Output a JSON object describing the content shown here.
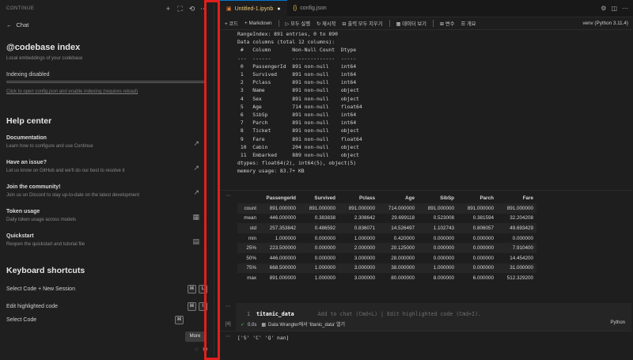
{
  "left": {
    "top_title": "CONTINUE",
    "chat_label": "Chat",
    "index": {
      "title": "@codebase index",
      "subtitle": "Local embeddings of your codebase",
      "status": "Indexing disabled",
      "link": "Click to open config.json and enable indexing (requires reload)"
    },
    "help": {
      "title": "Help center",
      "items": [
        {
          "title": "Documentation",
          "desc": "Learn how to configure and use Continue"
        },
        {
          "title": "Have an issue?",
          "desc": "Let us know on GitHub and we'll do our best to resolve it"
        },
        {
          "title": "Join the community!",
          "desc": "Join us on Discord to stay up-to-date on the latest development"
        },
        {
          "title": "Token usage",
          "desc": "Daily token usage across models"
        },
        {
          "title": "Quickstart",
          "desc": "Reopen the quickstart and tutorial file"
        }
      ]
    },
    "shortcuts": {
      "title": "Keyboard shortcuts",
      "rows": [
        {
          "label": "Select Code + New Session",
          "keys": [
            "⌘",
            "L"
          ]
        },
        {
          "label": "Edit highlighted code",
          "keys": [
            "⌘",
            "I"
          ]
        },
        {
          "label": "Select Code",
          "keys": [
            "⌘"
          ]
        }
      ]
    },
    "tooltip": "More"
  },
  "tabs": [
    {
      "name": "Untitled-1.ipynb",
      "modified": true,
      "active": true
    },
    {
      "name": "config.json",
      "modified": false,
      "active": false
    }
  ],
  "toolbar": {
    "items": [
      "+ 코드",
      "+ Markdown",
      "▷ 모두 실행",
      "↻ 재시작",
      "⊟ 출력 모두 지우기",
      "▦ 데이터 보기",
      "⊞ 변수",
      "☰ 개요"
    ],
    "kernel": "venv (Python 3.11.4)"
  },
  "output1": {
    "lines": [
      "RangeIndex: 891 entries, 0 to 890",
      "Data columns (total 12 columns):",
      " #   Column       Non-Null Count  Dtype  ",
      "---  ------       --------------  -----  ",
      " 0   PassengerId  891 non-null    int64  ",
      " 1   Survived     891 non-null    int64  ",
      " 2   Pclass       891 non-null    int64  ",
      " 3   Name         891 non-null    object ",
      " 4   Sex          891 non-null    object ",
      " 5   Age          714 non-null    float64",
      " 6   SibSp        891 non-null    int64  ",
      " 7   Parch        891 non-null    int64  ",
      " 8   Ticket       891 non-null    object ",
      " 9   Fare         891 non-null    float64",
      " 10  Cabin        204 non-null    object ",
      " 11  Embarked     889 non-null    object ",
      "dtypes: float64(2), int64(5), object(5)",
      "memory usage: 83.7+ KB"
    ]
  },
  "describe": {
    "columns": [
      "",
      "PassengerId",
      "Survived",
      "Pclass",
      "Age",
      "SibSp",
      "Parch",
      "Fare"
    ],
    "rows": [
      [
        "count",
        "891.000000",
        "891.000000",
        "891.000000",
        "714.000000",
        "891.000000",
        "891.000000",
        "891.000000"
      ],
      [
        "mean",
        "446.000000",
        "0.383838",
        "2.308642",
        "29.699118",
        "0.523008",
        "0.381594",
        "32.204208"
      ],
      [
        "std",
        "257.353842",
        "0.486592",
        "0.836071",
        "14.526497",
        "1.102743",
        "0.806057",
        "49.693429"
      ],
      [
        "min",
        "1.000000",
        "0.000000",
        "1.000000",
        "0.420000",
        "0.000000",
        "0.000000",
        "0.000000"
      ],
      [
        "25%",
        "223.500000",
        "0.000000",
        "2.000000",
        "20.125000",
        "0.000000",
        "0.000000",
        "7.910400"
      ],
      [
        "50%",
        "446.000000",
        "0.000000",
        "3.000000",
        "28.000000",
        "0.000000",
        "0.000000",
        "14.454200"
      ],
      [
        "75%",
        "668.500000",
        "1.000000",
        "3.000000",
        "38.000000",
        "1.000000",
        "0.000000",
        "31.000000"
      ],
      [
        "max",
        "891.000000",
        "1.000000",
        "3.000000",
        "80.000000",
        "8.000000",
        "6.000000",
        "512.329200"
      ]
    ]
  },
  "cell2": {
    "line_no": "1",
    "code": "titanic_data",
    "ghost": "Add to chat (Cmd+L) | Edit highlighted code (Cmd+I).",
    "exec_count": "[4]",
    "time": "0.0s",
    "status": "Data Wrangler에서 'titanic_data' 열기",
    "lang": "Python"
  },
  "output3": "['S' 'C' 'Q' nan]"
}
